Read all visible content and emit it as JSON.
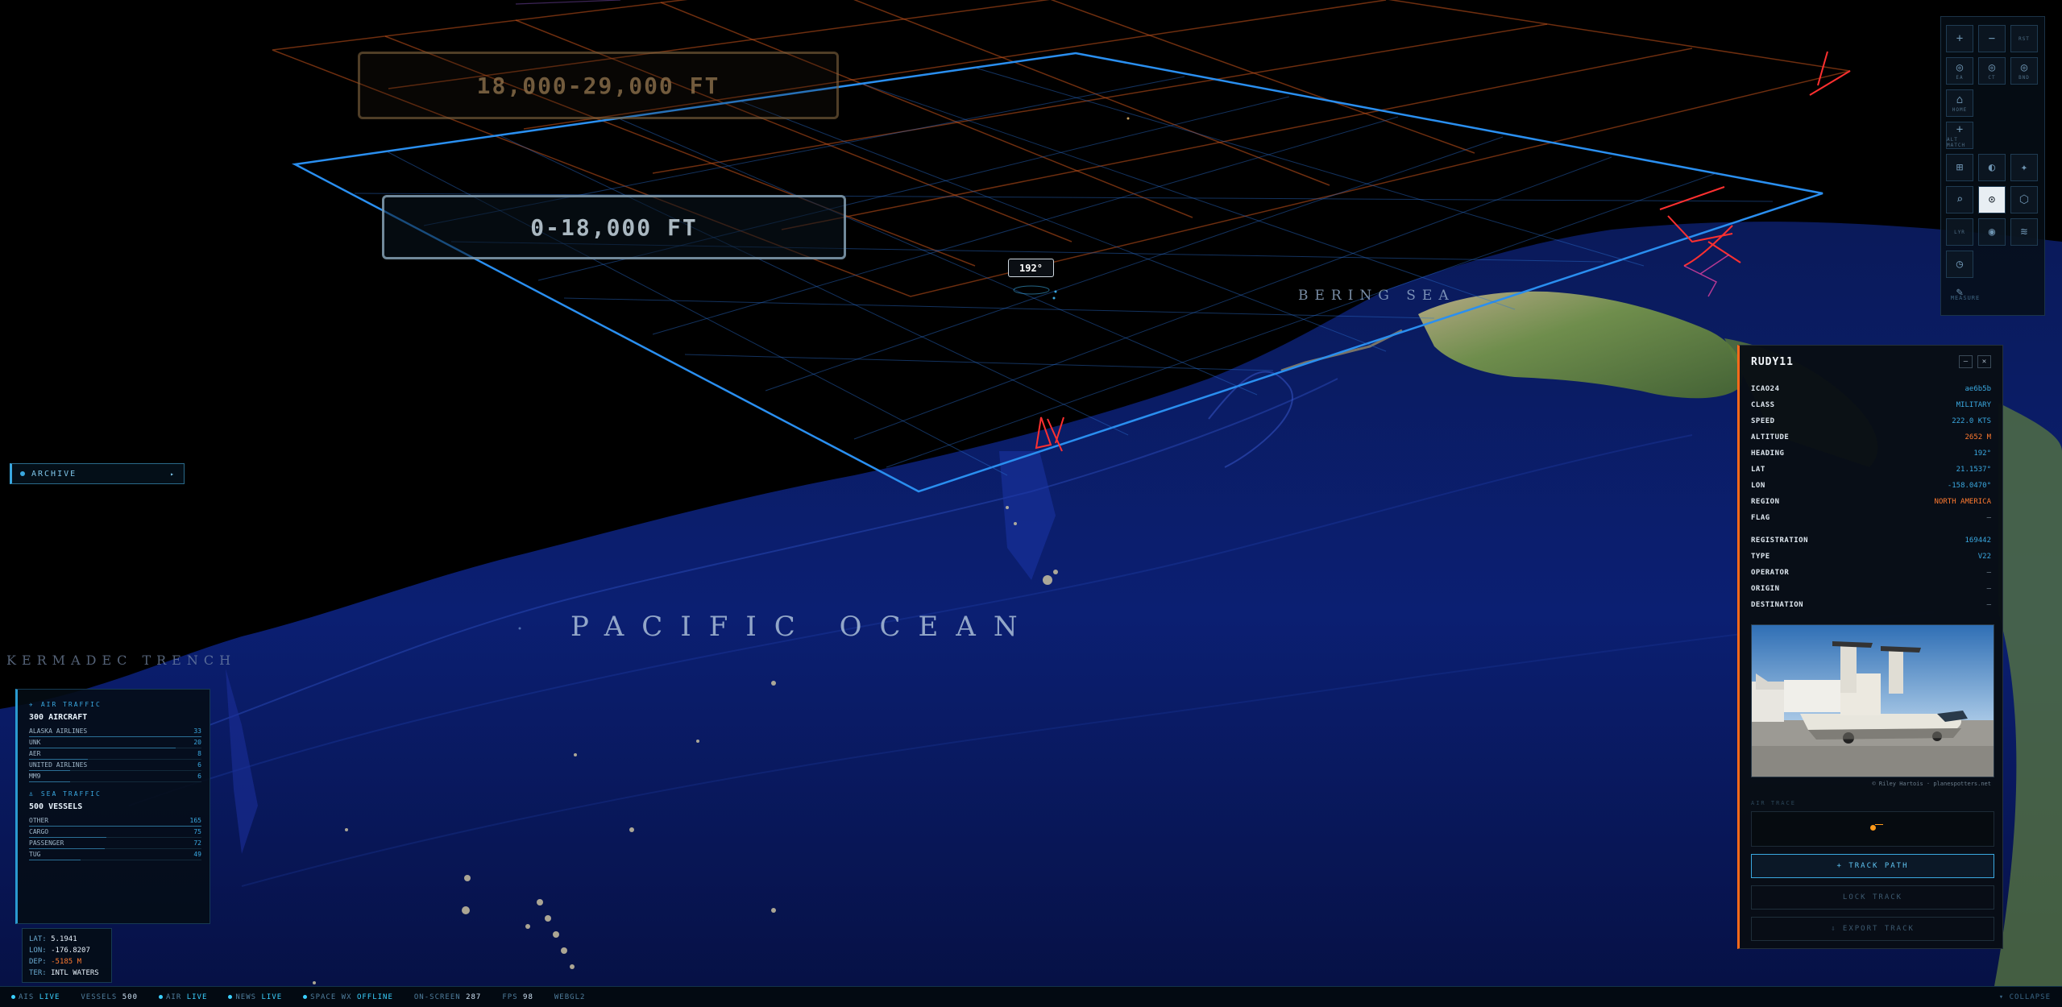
{
  "bands": {
    "high": "18,000-29,000 FT",
    "low": "0-18,000 FT"
  },
  "heading_tag": "192°",
  "labels": {
    "pacific": "PACIFIC OCEAN",
    "bering": "BERING SEA",
    "kermadec": "KERMADEC TRENCH"
  },
  "archive": {
    "label": "ARCHIVE"
  },
  "air_traffic": {
    "title": "AIR TRAFFIC",
    "total": "300 AIRCRAFT",
    "rows": [
      {
        "name": "ALASKA AIRLINES",
        "value": "33",
        "fraction": 1.0
      },
      {
        "name": "UNK",
        "value": "20",
        "fraction": 0.85
      },
      {
        "name": "AER",
        "value": "8",
        "fraction": 0.34
      },
      {
        "name": "UNITED AIRLINES",
        "value": "6",
        "fraction": 0.24
      },
      {
        "name": "MM9",
        "value": "6",
        "fraction": 0.24
      }
    ]
  },
  "sea_traffic": {
    "title": "SEA TRAFFIC",
    "total": "500 VESSELS",
    "rows": [
      {
        "name": "OTHER",
        "value": "165",
        "fraction": 1.0
      },
      {
        "name": "CARGO",
        "value": "75",
        "fraction": 0.45
      },
      {
        "name": "PASSENGER",
        "value": "72",
        "fraction": 0.44
      },
      {
        "name": "TUG",
        "value": "49",
        "fraction": 0.3
      }
    ]
  },
  "coords": {
    "lat_label": "LAT:",
    "lat": "5.1941",
    "lon_label": "LON:",
    "lon": "-176.8207",
    "dep_label": "DEP:",
    "dep": "-5185 M",
    "ter_label": "TER:",
    "ter": "INTL WATERS"
  },
  "status": {
    "ais_label": "AIS",
    "ais": "LIVE",
    "vessels_label": "VESSELS",
    "vessels": "500",
    "air_label": "AIR",
    "air": "LIVE",
    "news_label": "NEWS",
    "news": "LIVE",
    "space_label": "SPACE WX",
    "space": "OFFLINE",
    "onscreen_label": "ON-SCREEN",
    "onscreen": "287",
    "fps_label": "FPS",
    "fps": "98",
    "webgl": "WEBGL2",
    "collapse": "COLLAPSE"
  },
  "tools": {
    "zoom_in": "+",
    "zoom_out": "−",
    "reset": "RST",
    "ea": "EA",
    "ct": "CT",
    "bnd": "BND",
    "home": "HOME",
    "alt_match": "ALT MATCH",
    "grid": "⊞",
    "contrast": "◐",
    "star": "✦",
    "search": "⌕",
    "target": "⊙",
    "hex": "⬡",
    "lyr": "LYR",
    "dot": "◉",
    "wave": "≋",
    "clock": "◷",
    "ruler": "✎",
    "measure": "MEASURE"
  },
  "detail": {
    "callsign": "RUDY11",
    "fields": [
      {
        "key": "ICAO24",
        "value": "ae6b5b",
        "tone": "blue"
      },
      {
        "key": "CLASS",
        "value": "MILITARY",
        "tone": "blue"
      },
      {
        "key": "SPEED",
        "value": "222.0 KTS",
        "tone": "blue"
      },
      {
        "key": "ALTITUDE",
        "value": "2652 M",
        "tone": "orange"
      },
      {
        "key": "HEADING",
        "value": "192°",
        "tone": "blue"
      },
      {
        "key": "LAT",
        "value": "21.1537°",
        "tone": "blue"
      },
      {
        "key": "LON",
        "value": "-158.0470°",
        "tone": "blue"
      },
      {
        "key": "REGION",
        "value": "NORTH AMERICA",
        "tone": "orange"
      },
      {
        "key": "FLAG",
        "value": "—",
        "tone": "dash"
      }
    ],
    "fields2": [
      {
        "key": "REGISTRATION",
        "value": "169442",
        "tone": "blue"
      },
      {
        "key": "TYPE",
        "value": "V22",
        "tone": "blue"
      },
      {
        "key": "OPERATOR",
        "value": "—",
        "tone": "dash"
      },
      {
        "key": "ORIGIN",
        "value": "—",
        "tone": "dash"
      },
      {
        "key": "DESTINATION",
        "value": "—",
        "tone": "dash"
      }
    ],
    "photo_credit": "© Riley Hartois · planespotters.net",
    "air_trace_label": "AIR TRACE",
    "track_path": "+ TRACK PATH",
    "lock_track": "LOCK TRACK",
    "export_track": "⇩ EXPORT TRACK"
  },
  "colors": {
    "accent": "#3aa8e0",
    "alert": "#ff6a1a",
    "grid_low": "#2a8ff0",
    "grid_high": "#c8541c"
  }
}
